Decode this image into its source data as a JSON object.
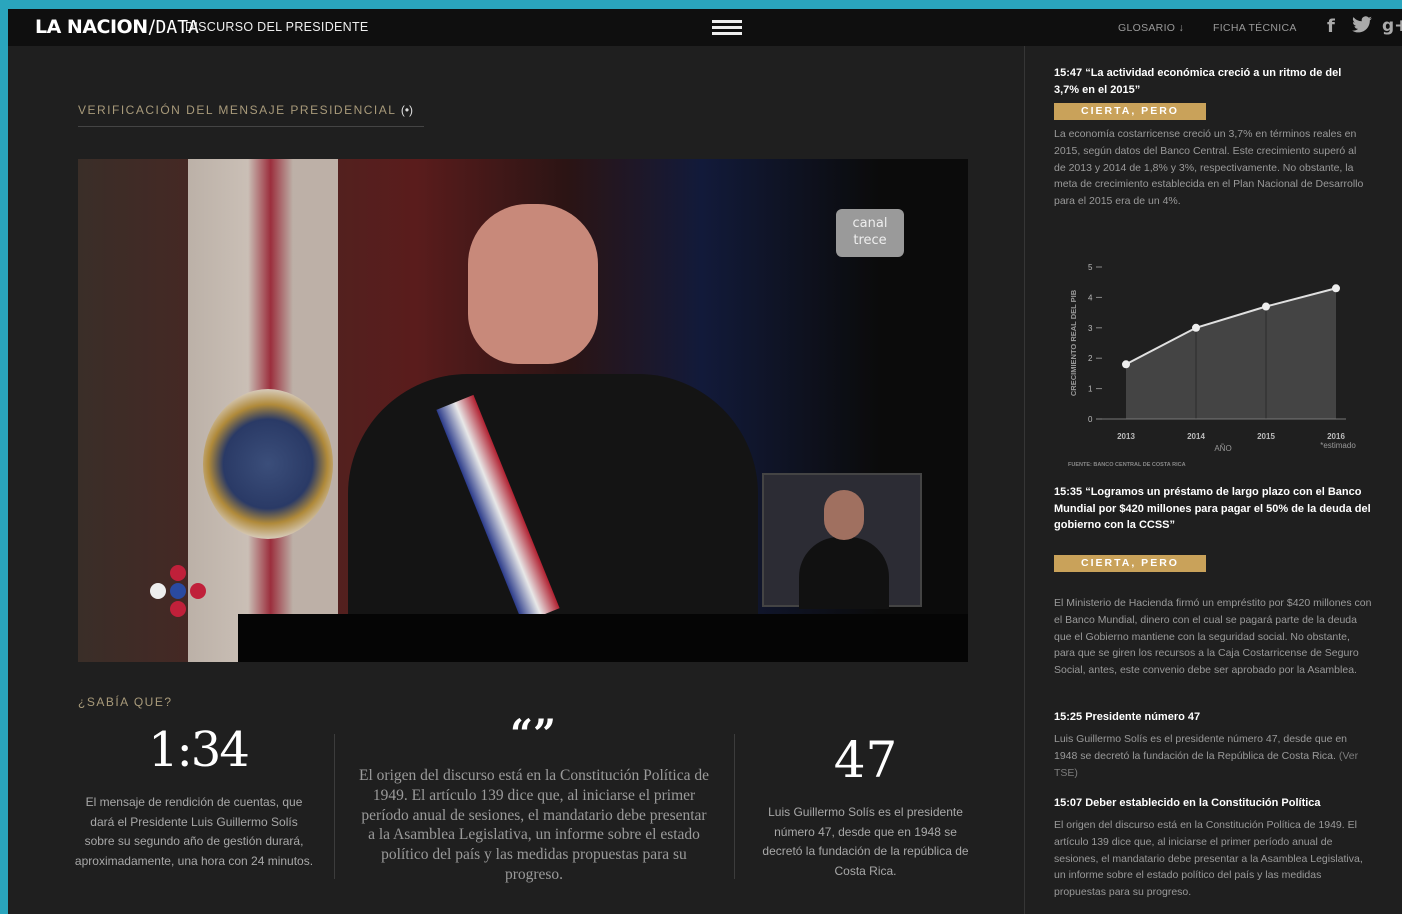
{
  "topbar": {
    "logo_brand": "LA NACION",
    "logo_data": "DATA",
    "section_title": "DISCURSO DEL PRESIDENTE",
    "nav_glosario": "GLOSARIO ↓",
    "nav_ficha": "FICHA TÉCNICA",
    "social": [
      "f",
      "t",
      "g+"
    ]
  },
  "main": {
    "verification_label": "VERIFICACIÓN DEL MENSAJE PRESIDENCIAL",
    "video_badge": "canal trece",
    "did_you_know": "¿SABÍA QUE?",
    "stat1_value": "1:34",
    "stat1_text": "El mensaje de rendición de cuentas, que dará el Presidente Luis Guillermo Solís sobre su segundo año de gestión durará, aproximadamente, una hora con 24 minutos.",
    "quote_mark": "“”",
    "quote_text": "El origen del discurso está en la Constitución Política de 1949. El artículo 139 dice que, al iniciarse el primer período anual de sesiones, el mandatario debe presentar a la Asamblea Legislativa, un informe sobre el estado político del país y las medidas propuestas para su progreso.",
    "stat3_value": "47",
    "stat3_text": "Luis Guillermo Solís es el presidente número 47, desde que en 1948 se decretó la fundación de la república de Costa Rica."
  },
  "sidebar": {
    "items": [
      {
        "title": "15:47  “La actividad económica creció a un ritmo de del 3,7% en el 2015”",
        "verdict": "CIERTA, PERO",
        "body": "La economía costarricense creció un 3,7% en términos reales en 2015, según datos del Banco Central. Este crecimiento superó al de 2013 y 2014 de 1,8% y 3%, respectivamente. No obstante, la meta de crecimiento establecida en el Plan Nacional de Desarrollo para el 2015 era de un 4%."
      },
      {
        "title": "15:35  “Logramos un préstamo de largo plazo con el Banco Mundial por $420 millones para pagar el 50% de la deuda del gobierno con la CCSS”",
        "verdict": "CIERTA, PERO",
        "body": "El Ministerio de Hacienda firmó un empréstito por $420 millones con el Banco Mundial, dinero con el cual se pagará parte de la deuda que el Gobierno mantiene con la seguridad social. No obstante, para que se giren los recursos a la Caja Costarricense de Seguro Social, antes, este convenio debe ser aprobado por la Asamblea."
      },
      {
        "title": "15:25  Presidente número 47",
        "body": "Luis Guillermo Solís es el presidente número 47, desde que en 1948 se decretó la fundación de la República de Costa Rica.",
        "link": "(Ver TSE)"
      },
      {
        "title": "15:07  Deber establecido en la Constitución Política",
        "body": "El origen del discurso está en la Constitución Política de 1949. El artículo 139 dice que, al iniciarse el primer período anual de sesiones, el mandatario debe presentar a la Asamblea Legislativa, un informe sobre el estado político del país y las medidas propuestas para su progreso."
      }
    ]
  },
  "chart_data": {
    "type": "area",
    "categories": [
      "2013",
      "2014",
      "2015",
      "2016"
    ],
    "values": [
      1.8,
      3.0,
      3.7,
      4.3
    ],
    "ylabel": "CRECIMIENTO REAL DEL PIB",
    "xlabel": "AÑO",
    "yticks": [
      "0",
      "1",
      "2",
      "3",
      "4",
      "5"
    ],
    "ylim": [
      0,
      5
    ],
    "annotation": "*estimado",
    "source": "FUENTE: BANCO CENTRAL DE COSTA RICA",
    "colors": {
      "line": "#e0e0e0",
      "fill": "#444444",
      "point": "#eeeeee"
    }
  }
}
